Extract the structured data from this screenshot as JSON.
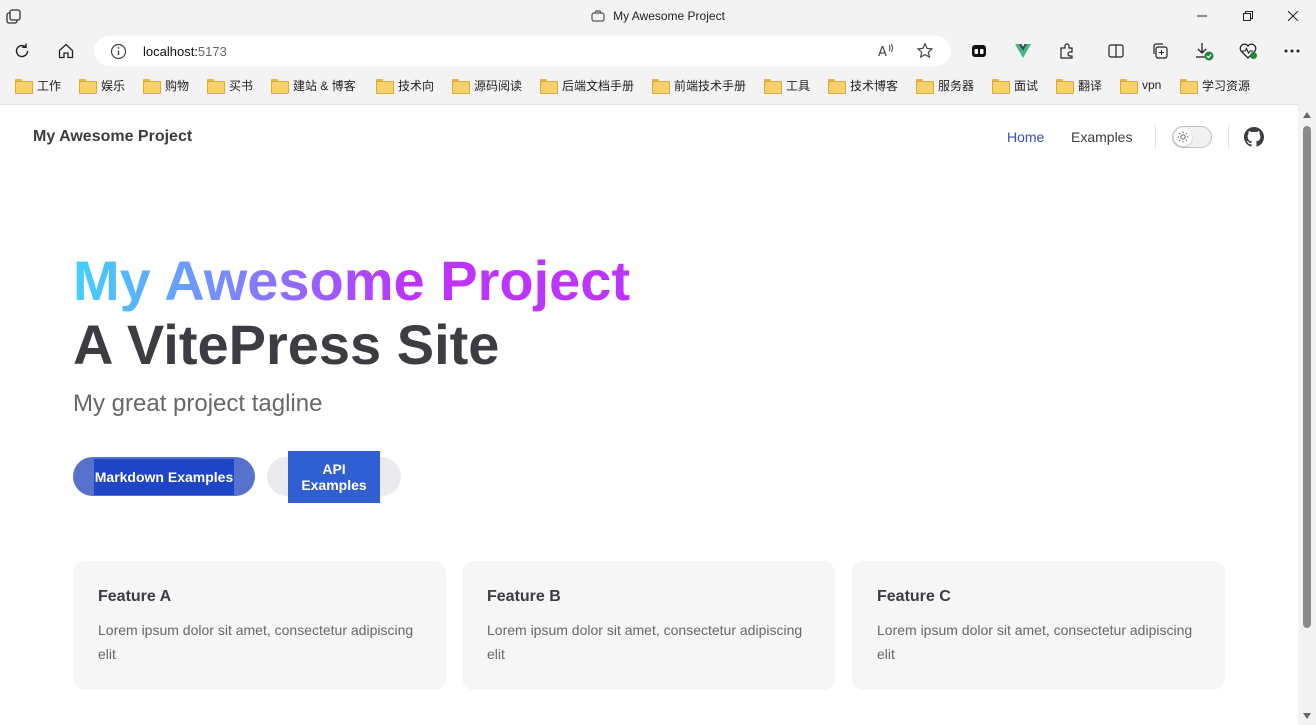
{
  "window": {
    "title": "My Awesome Project"
  },
  "browser": {
    "address_host": "localhost:",
    "address_port": "5173",
    "bookmarks": [
      "工作",
      "娱乐",
      "购物",
      "买书",
      "建站 & 博客",
      "技术向",
      "源码阅读",
      "后端文档手册",
      "前端技术手册",
      "工具",
      "技术博客",
      "服务器",
      "面试",
      "翻译",
      "vpn",
      "学习资源"
    ]
  },
  "nav": {
    "site_title": "My Awesome Project",
    "links": [
      "Home",
      "Examples"
    ]
  },
  "hero": {
    "name": "My Awesome Project",
    "text": "A VitePress Site",
    "tagline": "My great project tagline",
    "actions": [
      "Markdown Examples",
      "API Examples"
    ]
  },
  "features": [
    {
      "title": "Feature A",
      "details": "Lorem ipsum dolor sit amet, consectetur adipiscing elit"
    },
    {
      "title": "Feature B",
      "details": "Lorem ipsum dolor sit amet, consectetur adipiscing elit"
    },
    {
      "title": "Feature C",
      "details": "Lorem ipsum dolor sit amet, consectetur adipiscing elit"
    }
  ],
  "colors": {
    "brand": "#3451b2",
    "hero_gradient_start": "#41d1ff",
    "hero_gradient_end": "#bd34fe"
  }
}
